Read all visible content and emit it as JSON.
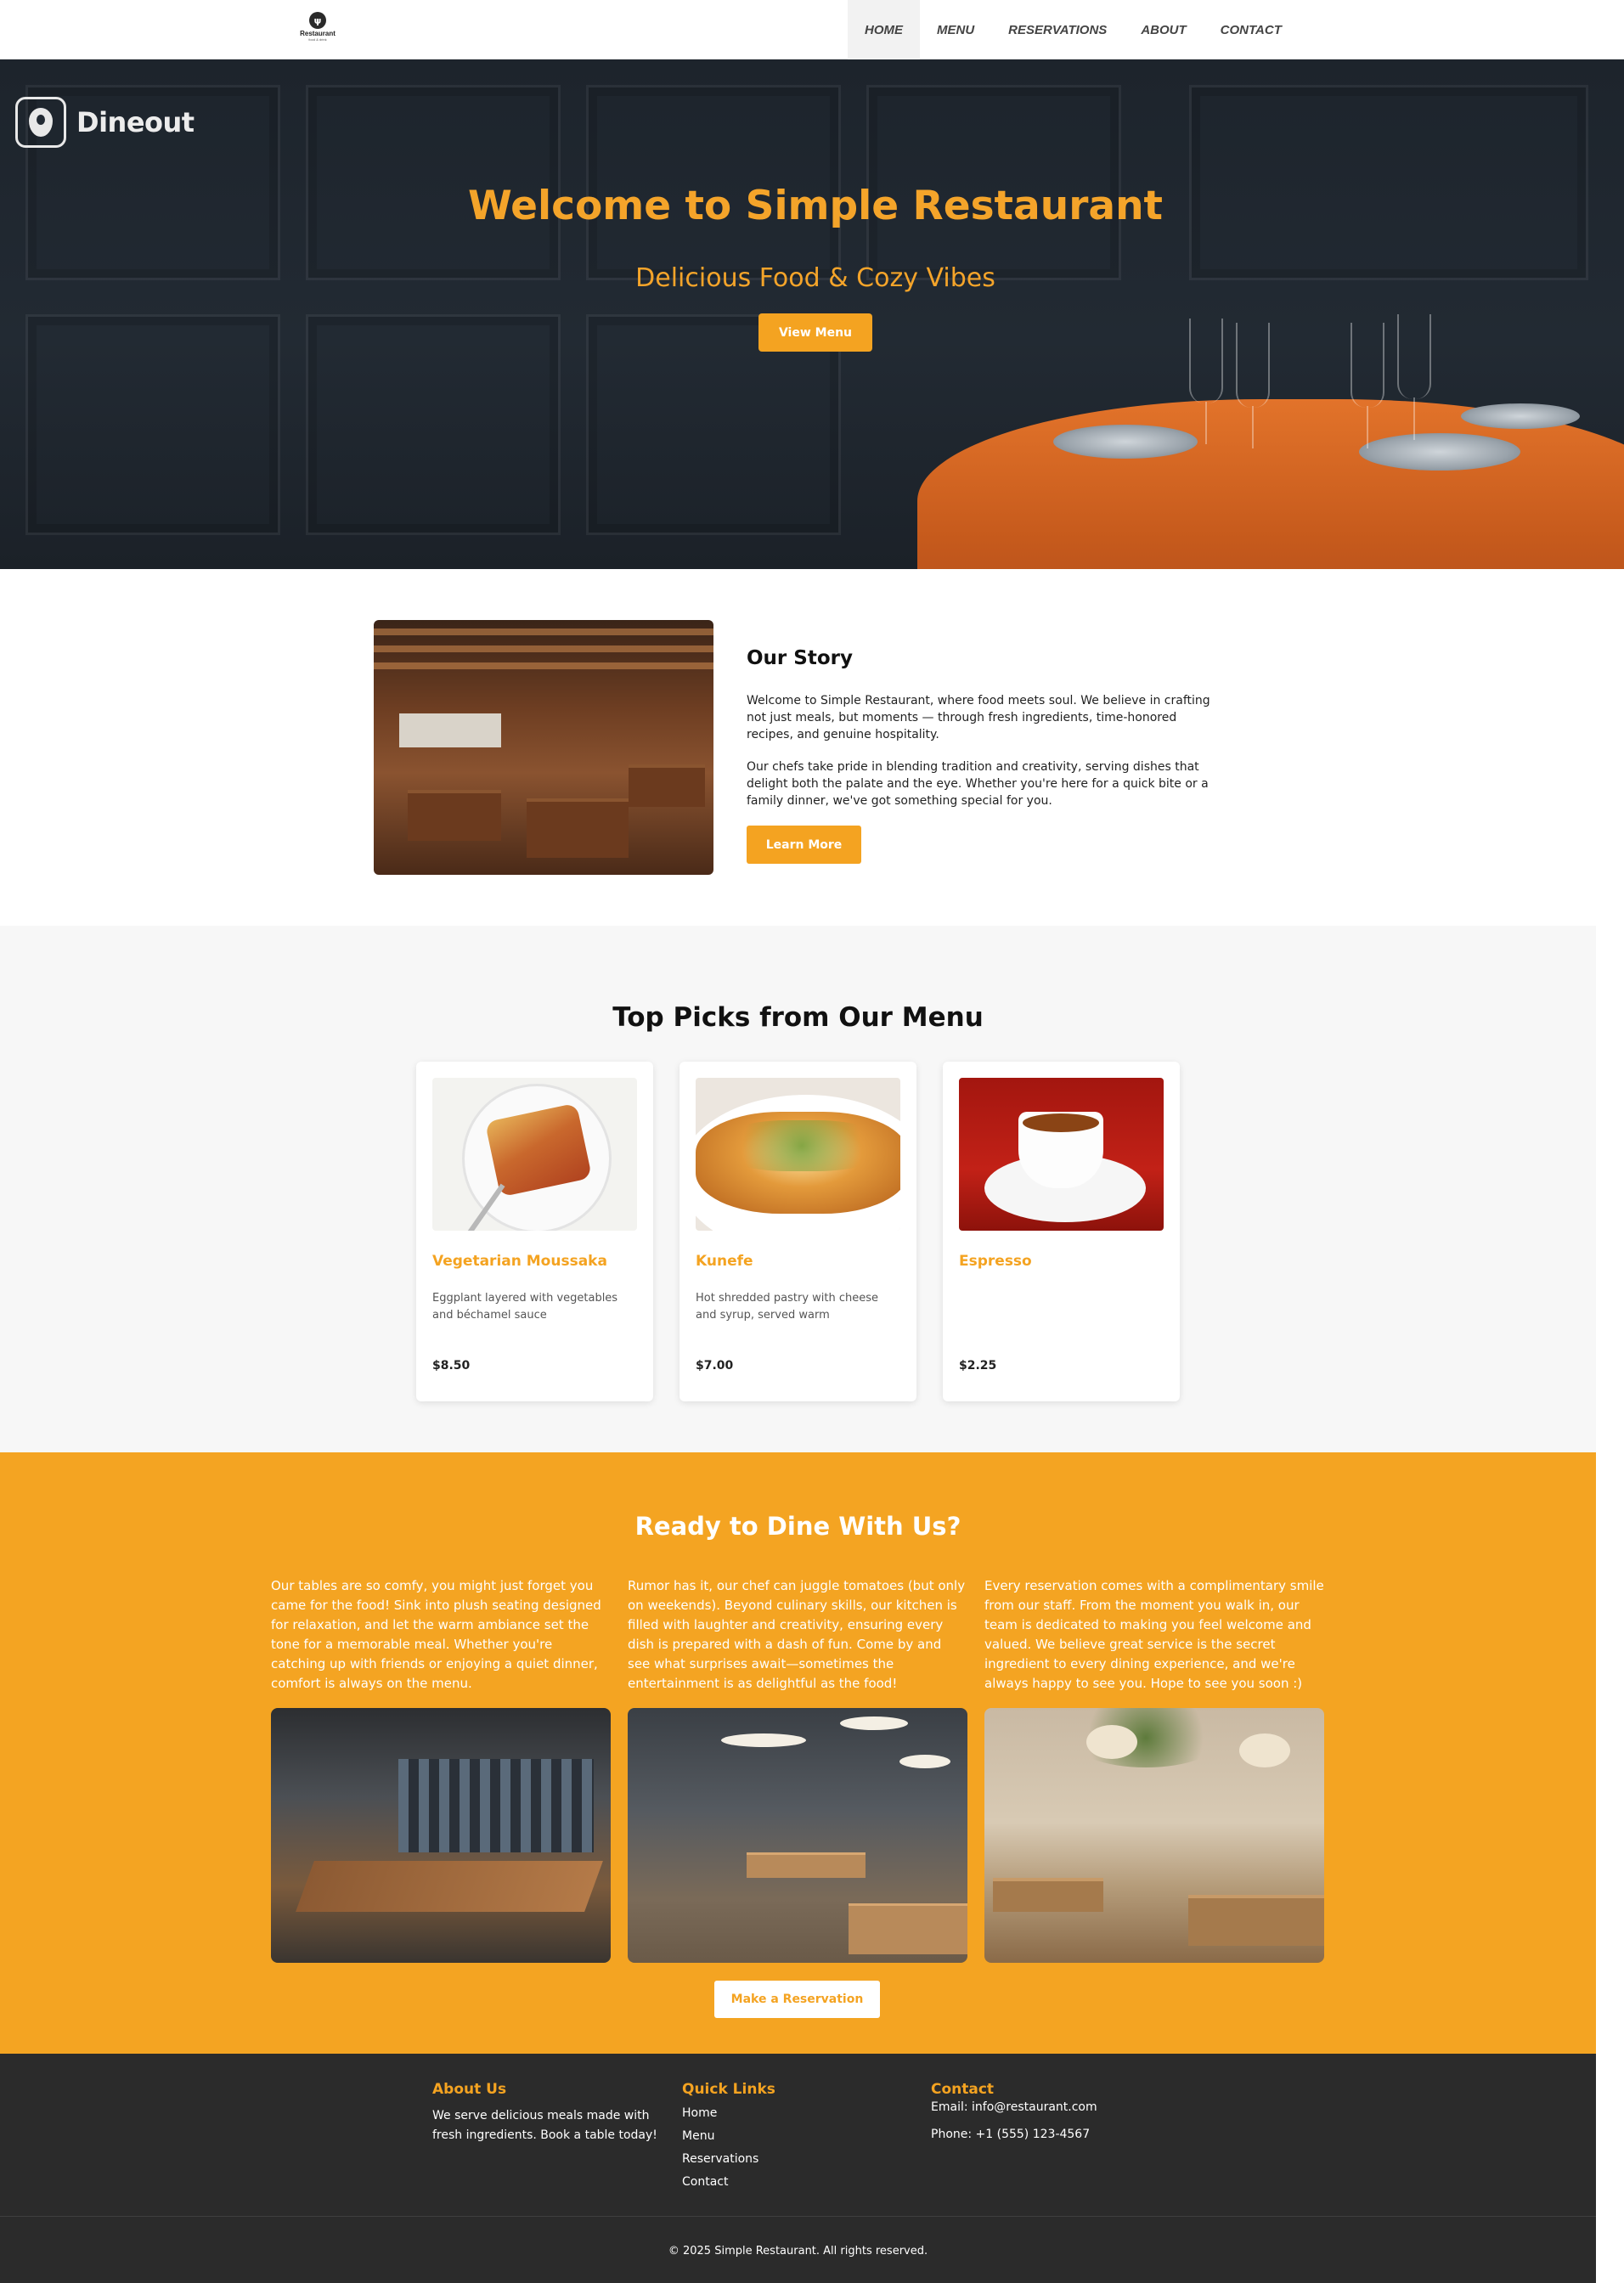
{
  "brand": {
    "logo_glyph": "ψ",
    "logo_text": "Restaurant",
    "logo_subtext": "food & drink"
  },
  "nav": {
    "items": [
      {
        "label": "HOME",
        "active": true
      },
      {
        "label": "MENU",
        "active": false
      },
      {
        "label": "RESERVATIONS",
        "active": false
      },
      {
        "label": "ABOUT",
        "active": false
      },
      {
        "label": "CONTACT",
        "active": false
      }
    ]
  },
  "hero": {
    "watermark": "Dineout",
    "title": "Welcome to Simple Restaurant",
    "subtitle": "Delicious Food & Cozy Vibes",
    "button_label": "View Menu"
  },
  "story": {
    "title": "Our Story",
    "paragraph_1": "Welcome to Simple Restaurant, where food meets soul. We believe in crafting not just meals, but moments — through fresh ingredients, time-honored recipes, and genuine hospitality.",
    "paragraph_2": "Our chefs take pride in blending tradition and creativity, serving dishes that delight both the palate and the eye. Whether you're here for a quick bite or a family dinner, we've got something special for you.",
    "button_label": "Learn More"
  },
  "menu": {
    "title": "Top Picks from Our Menu",
    "items": [
      {
        "name": "Vegetarian Moussaka",
        "description": "Eggplant layered with vegetables and béchamel sauce",
        "price": "$8.50"
      },
      {
        "name": "Kunefe",
        "description": "Hot shredded pastry with cheese and syrup, served warm",
        "price": "$7.00"
      },
      {
        "name": "Espresso",
        "description": "",
        "price": "$2.25"
      }
    ]
  },
  "dine": {
    "title": "Ready to Dine With Us?",
    "columns": [
      {
        "text": "Our tables are so comfy, you might just forget you came for the food! Sink into plush seating designed for relaxation, and let the warm ambiance set the tone for a memorable meal. Whether you're catching up with friends or enjoying a quiet dinner, comfort is always on the menu."
      },
      {
        "text": "Rumor has it, our chef can juggle tomatoes (but only on weekends). Beyond culinary skills, our kitchen is filled with laughter and creativity, ensuring every dish is prepared with a dash of fun. Come by and see what surprises await—sometimes the entertainment is as delightful as the food!"
      },
      {
        "text": "Every reservation comes with a complimentary smile from our staff. From the moment you walk in, our team is dedicated to making you feel welcome and valued. We believe great service is the secret ingredient to every dining experience, and we're always happy to see you. Hope to see you soon :)"
      }
    ],
    "button_label": "Make a Reservation"
  },
  "footer": {
    "about_heading": "About Us",
    "about_text": "We serve delicious meals made with fresh ingredients. Book a table today!",
    "links_heading": "Quick Links",
    "links": [
      "Home",
      "Menu",
      "Reservations",
      "Contact"
    ],
    "contact_heading": "Contact",
    "email": "Email: info@restaurant.com",
    "phone": "Phone: +1 (555) 123-4567",
    "copyright": "© 2025 Simple Restaurant. All rights reserved."
  },
  "colors": {
    "accent": "#f4a321",
    "footer_bg": "#2b2b2b",
    "menu_bg": "#f7f7f7"
  }
}
